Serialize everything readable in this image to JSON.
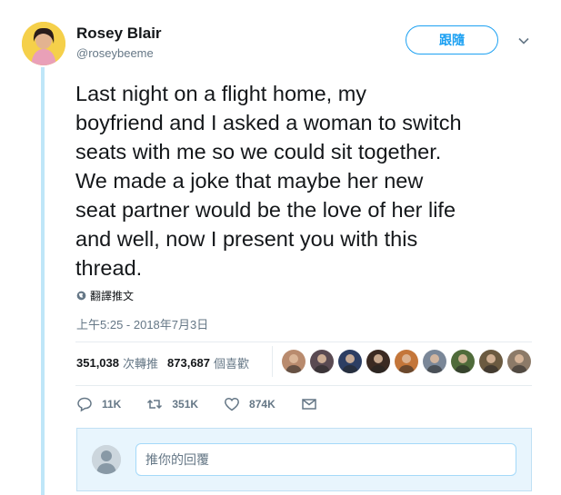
{
  "tweet": {
    "author": {
      "name": "Rosey Blair",
      "handle": "@roseybeeme"
    },
    "follow_label": "跟隨",
    "text": "Last night on a flight home, my\nboyfriend and I asked a woman to switch\nseats with me so we could sit together.\nWe made a joke that maybe her new\nseat partner would be the love of her life\nand well, now I present you with this\nthread.",
    "translate_label": "翻譯推文",
    "timestamp": "上午5:25 - 2018年7月3日"
  },
  "stats": {
    "retweets": {
      "count": "351,038",
      "label": "次轉推"
    },
    "likes": {
      "count": "873,687",
      "label": "個喜歡"
    }
  },
  "likers": [
    {
      "icon": "liker-avatar",
      "color": "#b98b6e"
    },
    {
      "icon": "liker-avatar",
      "color": "#5a4a52"
    },
    {
      "icon": "liker-avatar",
      "color": "#2c3e63"
    },
    {
      "icon": "liker-avatar",
      "color": "#3b2a22"
    },
    {
      "icon": "liker-avatar",
      "color": "#c4763a"
    },
    {
      "icon": "liker-avatar",
      "color": "#7a8798"
    },
    {
      "icon": "liker-avatar",
      "color": "#4f6b3a"
    },
    {
      "icon": "liker-avatar",
      "color": "#6b5a40"
    },
    {
      "icon": "liker-avatar",
      "color": "#8c7a68"
    }
  ],
  "actions": {
    "reply": {
      "icon": "reply-icon",
      "count": "11K"
    },
    "retweet": {
      "icon": "retweet-icon",
      "count": "351K"
    },
    "like": {
      "icon": "heart-icon",
      "count": "874K"
    },
    "message": {
      "icon": "envelope-icon"
    }
  },
  "reply_box": {
    "placeholder": "推你的回覆"
  },
  "colors": {
    "accent": "#1da1f2",
    "muted": "#657786",
    "thread_line": "#bfe6f8"
  }
}
